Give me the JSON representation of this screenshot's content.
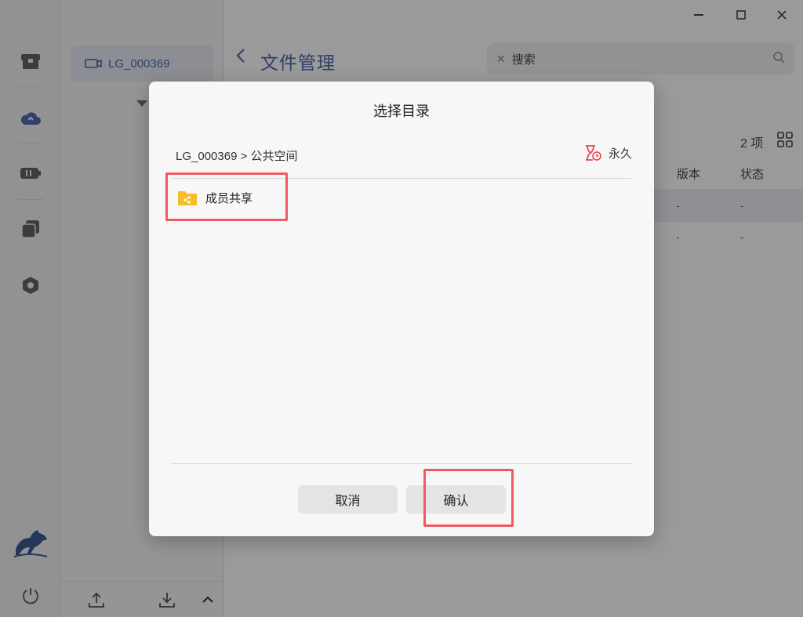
{
  "colors": {
    "accent": "#3d5aa8",
    "highlight_box": "#ee5a5f",
    "folder_yellow": "#f5bd2a",
    "retention_red": "#e8464a"
  },
  "sidebar": {
    "device_label": "LG_000369",
    "icons": [
      "archive-icon",
      "cloud-icon",
      "battery-icon",
      "copy-icon",
      "settings-icon",
      "horse-logo",
      "power-icon"
    ]
  },
  "header": {
    "title": "文件管理",
    "search_value": "搜索"
  },
  "list": {
    "count": "2 项",
    "columns": [
      "版本",
      "状态"
    ],
    "rows": [
      {
        "version": "-",
        "status": "-"
      },
      {
        "version": "-",
        "status": "-"
      }
    ]
  },
  "dialog": {
    "title": "选择目录",
    "breadcrumb": "LG_000369 > 公共空间",
    "retention_label": "永久",
    "folders": [
      {
        "name": "成员共享"
      }
    ],
    "cancel_label": "取消",
    "confirm_label": "确认"
  }
}
